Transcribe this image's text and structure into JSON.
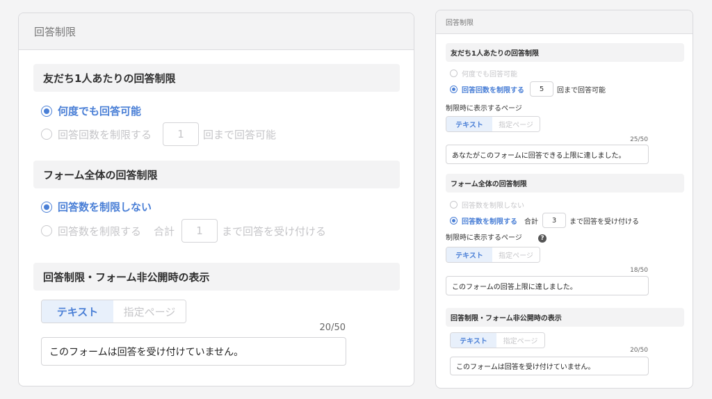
{
  "left": {
    "header_title": "回答制限",
    "per_friend": {
      "title": "友だち1人あたりの回答制限",
      "option_unlimited": "何度でも回答可能",
      "option_limit": "回答回数を制限する",
      "limit_value": "1",
      "limit_suffix": "回まで回答可能"
    },
    "form_total": {
      "title": "フォーム全体の回答制限",
      "option_unlimited": "回答数を制限しない",
      "option_limit": "回答数を制限する",
      "total_label": "合計",
      "limit_value": "1",
      "limit_suffix": "まで回答を受け付ける"
    },
    "closed_display": {
      "title": "回答制限・フォーム非公開時の表示",
      "tab_text": "テキスト",
      "tab_page": "指定ページ",
      "char_count": "20/50",
      "message": "このフォームは回答を受け付けていません。"
    }
  },
  "right": {
    "header_title": "回答制限",
    "per_friend": {
      "title": "友だち1人あたりの回答制限",
      "option_unlimited": "何度でも回答可能",
      "option_limit": "回答回数を制限する",
      "limit_value": "5",
      "limit_suffix": "回まで回答可能",
      "page_label": "制限時に表示するページ",
      "tab_text": "テキスト",
      "tab_page": "指定ページ",
      "char_count": "25/50",
      "message": "あなたがこのフォームに回答できる上限に達しました。"
    },
    "form_total": {
      "title": "フォーム全体の回答制限",
      "option_unlimited": "回答数を制限しない",
      "option_limit": "回答数を制限する",
      "total_label": "合計",
      "limit_value": "3",
      "limit_suffix": "まで回答を受け付ける",
      "page_label": "制限時に表示するページ",
      "help_icon": "?",
      "tab_text": "テキスト",
      "tab_page": "指定ページ",
      "char_count": "18/50",
      "message": "このフォームの回答上限に達しました。"
    },
    "closed_display": {
      "title": "回答制限・フォーム非公開時の表示",
      "tab_text": "テキスト",
      "tab_page": "指定ページ",
      "char_count": "20/50",
      "message": "このフォームは回答を受け付けていません。"
    }
  },
  "colors": {
    "accent": "#4a7fd6",
    "disabled_text": "#c5c5c8",
    "section_bg": "#f3f3f4"
  }
}
